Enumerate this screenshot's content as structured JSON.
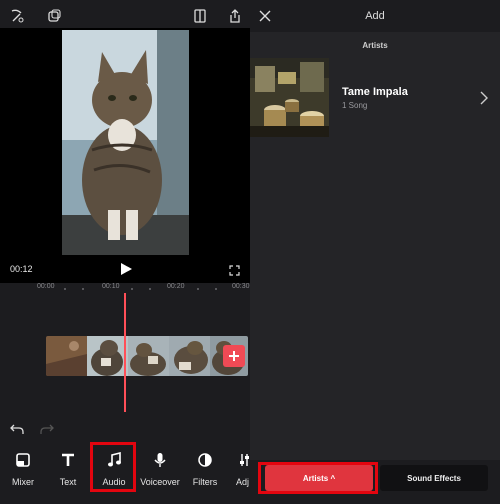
{
  "editor": {
    "time_label": "00:12",
    "ruler_ticks": [
      "00:00",
      "00:10",
      "00:20",
      "00:30"
    ],
    "tools": [
      {
        "label": "Mixer",
        "icon": "mixer-icon"
      },
      {
        "label": "Text",
        "icon": "text-icon"
      },
      {
        "label": "Audio",
        "icon": "music-note-icon"
      },
      {
        "label": "Voiceover",
        "icon": "microphone-icon"
      },
      {
        "label": "Filters",
        "icon": "filters-icon"
      },
      {
        "label": "Adj",
        "icon": "adjust-icon"
      }
    ]
  },
  "audio_panel": {
    "title": "Add",
    "section": "Artists",
    "artist": {
      "name": "Tame Impala",
      "sub": "1 Song"
    },
    "tabs": {
      "artists": "Artists ^",
      "sound_effects": "Sound Effects"
    }
  },
  "colors": {
    "accent": "#e0353e",
    "highlight": "#e3050f",
    "playhead": "#ff4f58"
  }
}
